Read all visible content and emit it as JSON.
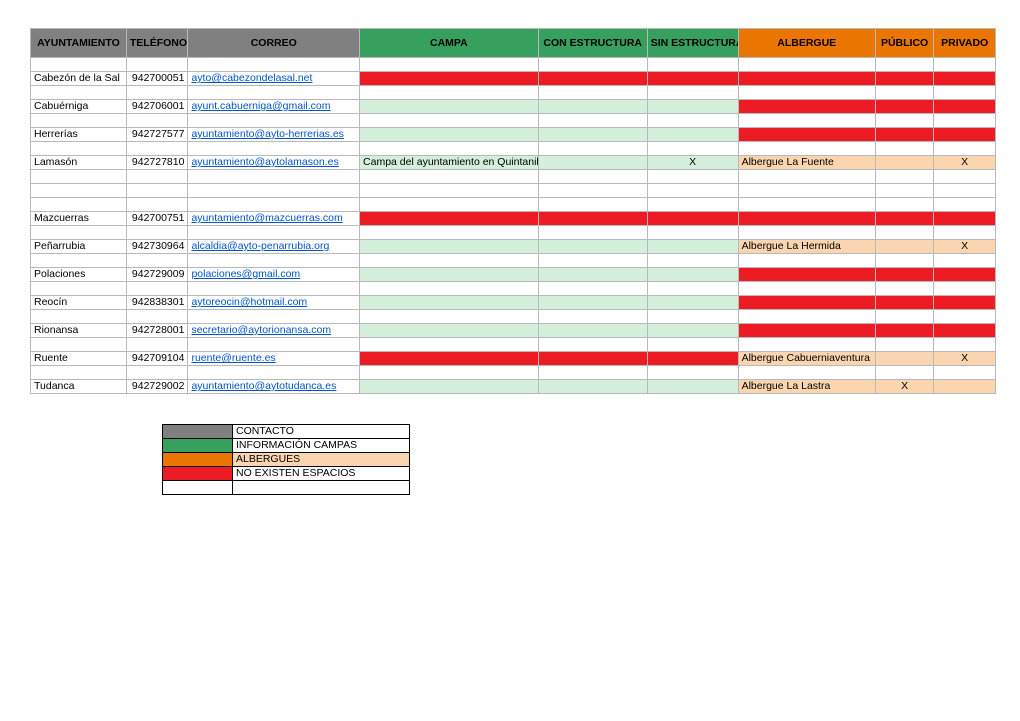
{
  "headers": {
    "ayuntamiento": "AYUNTAMIENTO",
    "telefono": "TELÉFONO",
    "correo": "CORREO",
    "campa": "CAMPA",
    "con_estructura": "CON ESTRUCTURA",
    "sin_estructura": "SIN ESTRUCTURA",
    "albergue": "ALBERGUE",
    "publico": "PÚBLICO",
    "privado": "PRIVADO"
  },
  "rows": [
    {
      "type": "blank"
    },
    {
      "type": "data",
      "ayto": "Cabezón de la Sal",
      "tel": "942700051",
      "correo": "ayto@cabezondelasal.net",
      "campa_bg": "red",
      "con_bg": "red",
      "sin_bg": "red",
      "alb_bg": "red",
      "pub_bg": "red",
      "priv_bg": "red"
    },
    {
      "type": "blank"
    },
    {
      "type": "data",
      "ayto": "Cabuérniga",
      "tel": "942706001",
      "correo": "ayunt.cabuerniga@gmail.com",
      "campa_bg": "lgreen",
      "con_bg": "lgreen",
      "sin_bg": "lgreen",
      "alb_bg": "red",
      "pub_bg": "red",
      "priv_bg": "red"
    },
    {
      "type": "blank"
    },
    {
      "type": "data",
      "ayto": "Herrerías",
      "tel": "942727577",
      "correo": "ayuntamiento@ayto-herrerias.es",
      "campa_bg": "lgreen",
      "con_bg": "lgreen",
      "sin_bg": "lgreen",
      "alb_bg": "red",
      "pub_bg": "red",
      "priv_bg": "red"
    },
    {
      "type": "blank"
    },
    {
      "type": "data",
      "ayto": "Lamasón",
      "tel": "942727810",
      "correo": "ayuntamiento@aytolamason.es",
      "campa": "Campa del ayuntamiento en Quintanilla",
      "campa_bg": "lgreen",
      "con_bg": "lgreen",
      "sin": "X",
      "sin_bg": "lgreen",
      "alb": "Albergue La Fuente",
      "alb_bg": "lorange",
      "pub_bg": "lorange",
      "priv": "X",
      "priv_bg": "lorange"
    },
    {
      "type": "blank"
    },
    {
      "type": "blank"
    },
    {
      "type": "blank"
    },
    {
      "type": "data",
      "ayto": "Mazcuerras",
      "tel": "942700751",
      "correo": "ayuntamiento@mazcuerras.com",
      "campa_bg": "red",
      "con_bg": "red",
      "sin_bg": "red",
      "alb_bg": "red",
      "pub_bg": "red",
      "priv_bg": "red"
    },
    {
      "type": "blank"
    },
    {
      "type": "data",
      "ayto": "Peñarrubia",
      "tel": "942730964",
      "correo": "alcaldia@ayto-penarrubia.org",
      "campa_bg": "lgreen",
      "con_bg": "lgreen",
      "sin_bg": "lgreen",
      "alb": "Albergue La Hermida",
      "alb_bg": "lorange",
      "pub_bg": "lorange",
      "priv": "X",
      "priv_bg": "lorange"
    },
    {
      "type": "blank"
    },
    {
      "type": "data",
      "ayto": "Polaciones",
      "tel": "942729009",
      "correo": "polaciones@gmail.com",
      "campa_bg": "lgreen",
      "con_bg": "lgreen",
      "sin_bg": "lgreen",
      "alb_bg": "red",
      "pub_bg": "red",
      "priv_bg": "red"
    },
    {
      "type": "blank"
    },
    {
      "type": "data",
      "ayto": "Reocín",
      "tel": "942838301",
      "correo": "aytoreocin@hotmail.com",
      "campa_bg": "lgreen",
      "con_bg": "lgreen",
      "sin_bg": "lgreen",
      "alb_bg": "red",
      "pub_bg": "red",
      "priv_bg": "red"
    },
    {
      "type": "blank"
    },
    {
      "type": "data",
      "ayto": "Rionansa",
      "tel": "942728001",
      "correo": "secretario@aytorionansa.com",
      "campa_bg": "lgreen",
      "con_bg": "lgreen",
      "sin_bg": "lgreen",
      "alb_bg": "red",
      "pub_bg": "red",
      "priv_bg": "red"
    },
    {
      "type": "blank"
    },
    {
      "type": "data",
      "ayto": "Ruente",
      "tel": "942709104",
      "correo": "ruente@ruente.es",
      "campa_bg": "red",
      "con_bg": "red",
      "sin_bg": "red",
      "alb": "Albergue Cabuerniaventura",
      "alb_bg": "lorange",
      "pub_bg": "lorange",
      "priv": "X",
      "priv_bg": "lorange"
    },
    {
      "type": "blank"
    },
    {
      "type": "data",
      "ayto": "Tudanca",
      "tel": "942729002",
      "correo": "ayuntamiento@aytotudanca.es",
      "campa_bg": "lgreen",
      "con_bg": "lgreen",
      "sin_bg": "lgreen",
      "alb": "Albergue La Lastra",
      "alb_bg": "lorange",
      "pub": "X",
      "pub_bg": "lorange",
      "priv_bg": "lorange"
    }
  ],
  "legend": {
    "contacto": "CONTACTO",
    "informacion": "INFORMACIÓN CAMPAS",
    "albergues": "ALBERGUES",
    "no_existen": "NO EXISTEN ESPACIOS"
  }
}
